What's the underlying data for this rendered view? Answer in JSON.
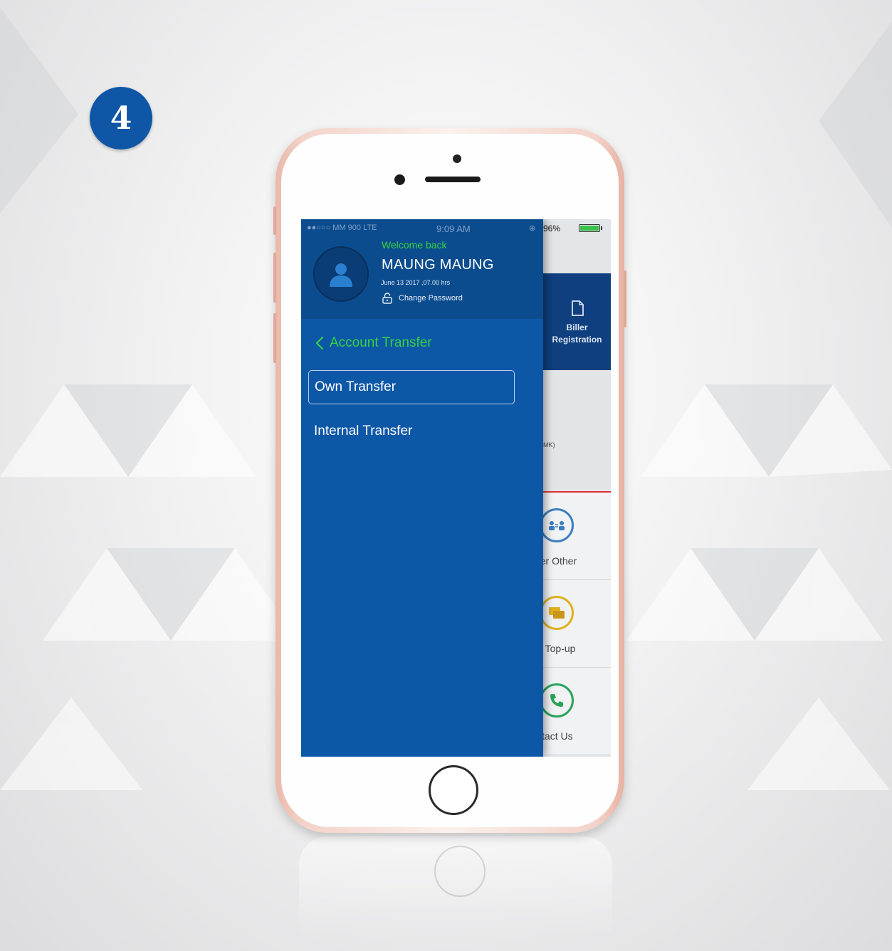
{
  "step": {
    "number": "4"
  },
  "colors": {
    "drawer_blue": "#0d57a7",
    "header_blue": "#0b4c8f",
    "accent_green": "#36d13f",
    "badge_blue": "#0f56a6"
  },
  "status_bar": {
    "carrier": "●●○○○ MM 900   LTE",
    "time": "9:09 AM",
    "battery": "96%",
    "battery_level": 0.96
  },
  "profile": {
    "welcome": "Welcome back",
    "name": "MAUNG MAUNG",
    "last_login": "June 13 2017 ,07.00 hrs",
    "change_password": "Change Password",
    "avatar_icon": "user-icon"
  },
  "drawer": {
    "section_title": "Account Transfer",
    "back_icon": "chevron-left-icon",
    "items": [
      {
        "label": "Own Transfer",
        "active": true
      },
      {
        "label": "Internal Transfer",
        "active": false
      }
    ]
  },
  "background_app": {
    "biller_label": "Biller\nRegistration",
    "balance_unit": "MK)",
    "rows": [
      {
        "label": "sfer Other",
        "icon": "transfer-users-icon",
        "color": "#3a7fc1"
      },
      {
        "label": "rd Top-up",
        "icon": "topup-card-icon",
        "color": "#e0b020"
      },
      {
        "label": "ntact Us",
        "icon": "phone-icon",
        "color": "#2aa35a"
      }
    ]
  }
}
